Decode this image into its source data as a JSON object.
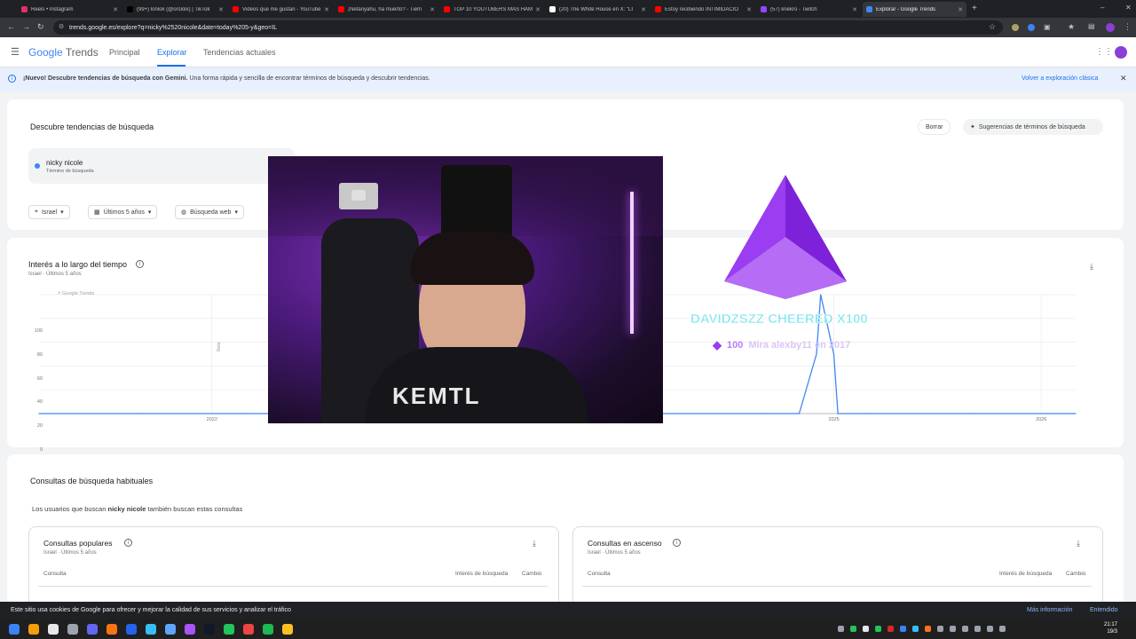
{
  "browser": {
    "tabs": [
      {
        "label": "Reels • Instagram",
        "color": "#e1306c"
      },
      {
        "label": "(99+) lonlok (@orslolx) | TikTok",
        "color": "#000000"
      },
      {
        "label": "Videos que me gustan - YouTube",
        "color": "#ff0000"
      },
      {
        "label": "¡Netanyahu, ha muerto? - Tiem",
        "color": "#ff0000"
      },
      {
        "label": "TOP 10 YOUTUBERS MÁS HAM",
        "color": "#ff0000"
      },
      {
        "label": "(20) The White House en X: \"LI",
        "color": "#ffffff"
      },
      {
        "label": "Estoy recibiendo INTIMIDACIO",
        "color": "#ff0000"
      },
      {
        "label": "(57) knekro - Twitch",
        "color": "#9146ff"
      },
      {
        "label": "Explorar - Google Trends",
        "color": "#4285f4"
      }
    ],
    "new_tab": "+",
    "url": "trends.google.es/explore?q=nicky%2520nicole&date=today%205-y&geo=IL"
  },
  "header": {
    "logo_google": "Google",
    "logo_trends": "Trends",
    "nav": [
      "Principal",
      "Explorar",
      "Tendencias actuales"
    ]
  },
  "banner": {
    "bold": "¡Nuevo! Descubre tendencias de búsqueda con Gemini.",
    "text": "Una forma rápida y sencilla de encontrar términos de búsqueda y descubrir tendencias.",
    "link": "Volver a exploración clásica"
  },
  "search": {
    "title": "Descubre tendencias de búsqueda",
    "clear": "Borrar",
    "suggest": "Sugerencias de términos de búsqueda",
    "term": "nicky nicole",
    "term_sub": "Término de búsqueda",
    "term_color": "#4285f4",
    "filters": {
      "location": "Israel",
      "period": "Últimos 5 años",
      "type": "Búsqueda web"
    }
  },
  "interest": {
    "title": "Interés a lo largo del tiempo",
    "sub": "Israel · Últimos 5 años",
    "watermark": "Google Trends",
    "note": "Nota"
  },
  "chart_data": {
    "type": "line",
    "x": [
      "2021-03",
      "2021-09",
      "2022-03",
      "2022-09",
      "2023-03",
      "2023-09",
      "2024-03",
      "2024-09",
      "2024-11",
      "2024-12",
      "2024-12",
      "2025-01",
      "2025-01",
      "2025-03",
      "2025-09",
      "2026-03"
    ],
    "series": [
      {
        "values": [
          0,
          0,
          0,
          0,
          0,
          0,
          0,
          0,
          0,
          50,
          100,
          50,
          0,
          0,
          0,
          0
        ]
      }
    ],
    "xticks": [
      "2022",
      "2025",
      "2026"
    ],
    "yticks": [
      0,
      20,
      40,
      60,
      80,
      100
    ],
    "ylim": [
      0,
      100
    ],
    "line_color": "#4285f4",
    "grid": true
  },
  "related": {
    "title": "Consultas de búsqueda habituales",
    "lead_pre": "Los usuarios que buscan",
    "lead_term": "nicky nicole",
    "lead_post": "también buscan estas consultas",
    "cards": [
      {
        "title": "Consultas populares",
        "sub": "Israel · Últimos 5 años",
        "col1": "Consulta",
        "col2": "Interés de búsqueda",
        "col3": "Cambio"
      },
      {
        "title": "Consultas en ascenso",
        "sub": "Israel · Últimos 5 años",
        "col1": "Consulta",
        "col2": "Interés de búsqueda",
        "col3": "Cambio"
      }
    ]
  },
  "cookie": {
    "text": "Este sitio usa cookies de Google para ofrecer y mejorar la calidad de sus servicios y analizar el tráfico",
    "more": "Más información",
    "ok": "Entendido"
  },
  "overlay": {
    "cheer": "DAVIDZSZZ CHEERED X100",
    "amount": "100",
    "message": "Mira alexby11 en 2017",
    "shirt": "KEMTL"
  },
  "taskbar": {
    "time": "21:17",
    "date": "19/3"
  }
}
